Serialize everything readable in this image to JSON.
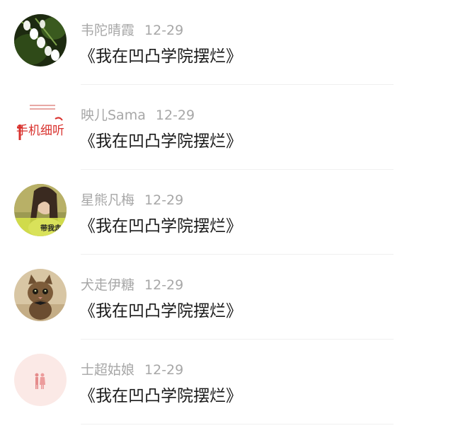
{
  "feed": {
    "items": [
      {
        "name": "韦陀晴霞",
        "date": "12-29",
        "title": "《我在凹凸学院摆烂》",
        "avatar_icon": "lily-of-the-valley-avatar"
      },
      {
        "name": "映儿Sama",
        "date": "12-29",
        "title": "《我在凹凸学院摆烂》",
        "avatar_icon": "handwritten-logo-avatar",
        "avatar_text": "手机细听"
      },
      {
        "name": "星熊凡梅",
        "date": "12-29",
        "title": "《我在凹凸学院摆烂》",
        "avatar_icon": "portrait-photo-avatar",
        "avatar_text": "带我走"
      },
      {
        "name": "犬走伊糖",
        "date": "12-29",
        "title": "《我在凹凸学院摆烂》",
        "avatar_icon": "kitten-photo-avatar"
      },
      {
        "name": "士超姑娘",
        "date": "12-29",
        "title": "《我在凹凸学院摆烂》",
        "avatar_icon": "pink-couple-avatar"
      }
    ]
  },
  "colors": {
    "name_text": "#a7a7a7",
    "title_text": "#1a1a1a",
    "divider": "#f0f0f0",
    "logo_red": "#d9322e",
    "avatar_pink": "#fbe9e6"
  }
}
